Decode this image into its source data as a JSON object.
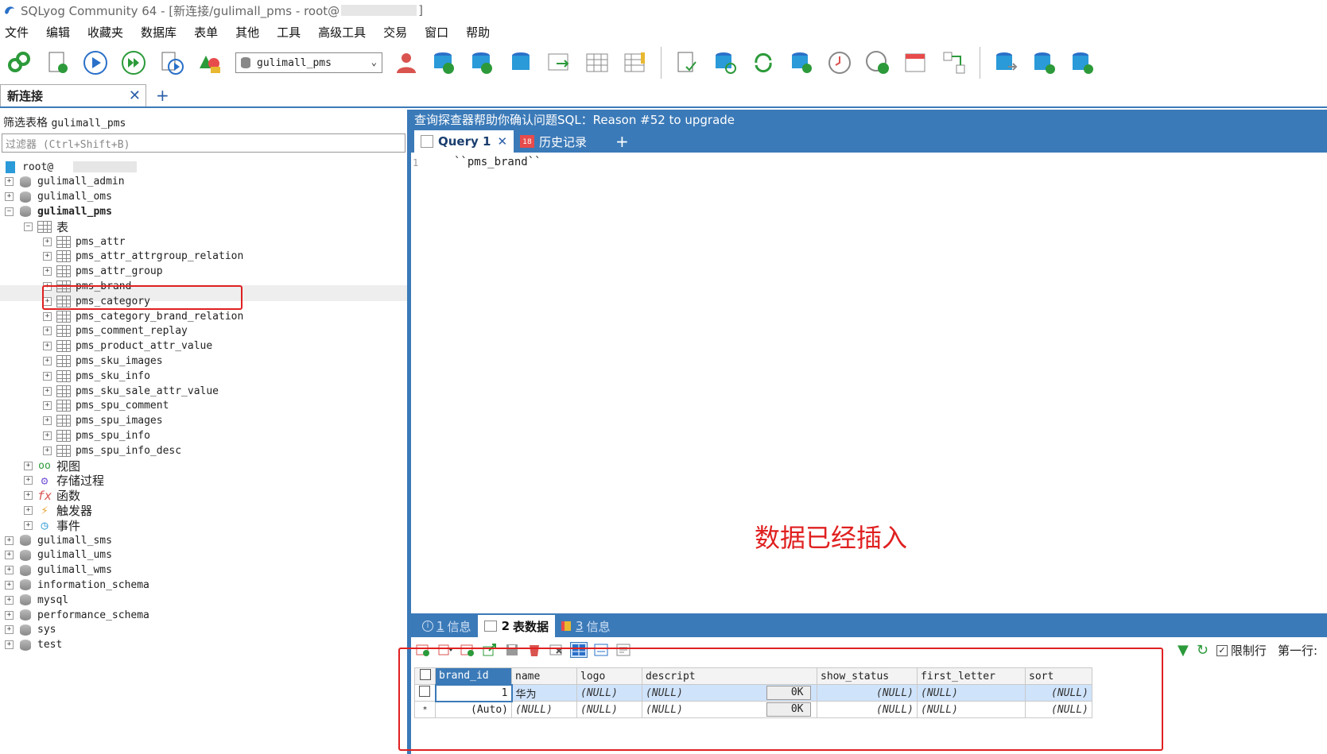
{
  "window": {
    "title_prefix": "SQLyog Community 64 - [新连接/gulimall_pms - root@",
    "title_suffix": "]"
  },
  "menu": [
    "文件",
    "编辑",
    "收藏夹",
    "数据库",
    "表单",
    "其他",
    "工具",
    "高级工具",
    "交易",
    "窗口",
    "帮助"
  ],
  "toolbar": {
    "db_select": "gulimall_pms"
  },
  "connection_tabs": [
    {
      "label": "新连接"
    }
  ],
  "left": {
    "filter_label": "筛选表格",
    "filter_db": "gulimall_pms",
    "filter_placeholder": "过滤器 (Ctrl+Shift+B)",
    "root_label": "root@",
    "databases_before": [
      "gulimall_admin",
      "gulimall_oms"
    ],
    "expanded_db": "gulimall_pms",
    "tables_folder": "表",
    "tables": [
      "pms_attr",
      "pms_attr_attrgroup_relation",
      "pms_attr_group",
      "pms_brand",
      "pms_category",
      "pms_category_brand_relation",
      "pms_comment_replay",
      "pms_product_attr_value",
      "pms_sku_images",
      "pms_sku_info",
      "pms_sku_sale_attr_value",
      "pms_spu_comment",
      "pms_spu_images",
      "pms_spu_info",
      "pms_spu_info_desc"
    ],
    "folders": [
      "视图",
      "存储过程",
      "函数",
      "触发器",
      "事件"
    ],
    "databases_after": [
      "gulimall_sms",
      "gulimall_ums",
      "gulimall_wms",
      "information_schema",
      "mysql",
      "performance_schema",
      "sys",
      "test"
    ]
  },
  "right": {
    "banner": "查询探查器帮助你确认问题SQL：Reason #52 to upgrade",
    "query_tab": "Query 1",
    "history_tab": "历史记录",
    "editor_line_no": "1",
    "editor_code": "``pms_brand``",
    "annotation": "数据已经插入",
    "result_tabs": [
      {
        "num": "1",
        "label": "信息"
      },
      {
        "num": "2",
        "label": "表数据"
      },
      {
        "num": "3",
        "label": "信息"
      }
    ],
    "limit_label": "限制行",
    "first_row_label": "第一行:",
    "columns": [
      "brand_id",
      "name",
      "logo",
      "descript",
      "show_status",
      "first_letter",
      "sort"
    ],
    "rows": [
      {
        "marker": "",
        "brand_id": "1",
        "name": "华为",
        "logo": "(NULL)",
        "descript": "(NULL)",
        "ok": "0K",
        "show_status": "(NULL)",
        "first_letter": "(NULL)",
        "sort": "(NULL)"
      },
      {
        "marker": "*",
        "brand_id": "(Auto)",
        "name": "(NULL)",
        "logo": "(NULL)",
        "descript": "(NULL)",
        "ok": "0K",
        "show_status": "(NULL)",
        "first_letter": "(NULL)",
        "sort": "(NULL)"
      }
    ]
  },
  "colors": {
    "accent": "#3b7ab8",
    "annotation_red": "#e02020"
  }
}
